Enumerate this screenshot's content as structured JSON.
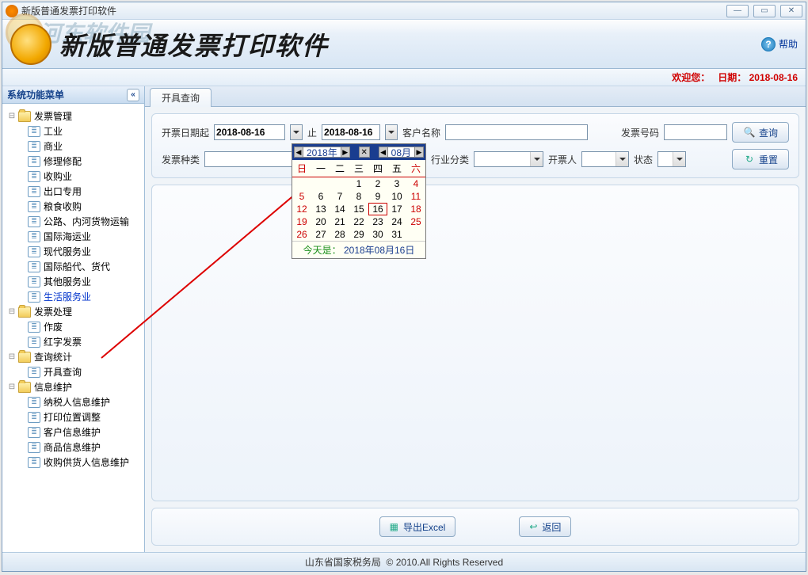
{
  "titlebar": {
    "title": "新版普通发票打印软件"
  },
  "header": {
    "watermark_text": "河东软件园",
    "app_title": "新版普通发票打印软件",
    "help": "帮助"
  },
  "statusline": {
    "welcome_prefix": "欢迎您：",
    "date_label": "日期：",
    "date_value": "2018-08-16"
  },
  "sidebar": {
    "title": "系统功能菜单",
    "groups": [
      {
        "label": "发票管理",
        "children": [
          "工业",
          "商业",
          "修理修配",
          "收购业",
          "出口专用",
          "粮食收购",
          "公路、内河货物运输",
          "国际海运业",
          "现代服务业",
          "国际船代、货代",
          "其他服务业",
          "生活服务业"
        ],
        "selected_index": 11
      },
      {
        "label": "发票处理",
        "children": [
          "作废",
          "红字发票"
        ]
      },
      {
        "label": "查询统计",
        "children": [
          "开具查询"
        ]
      },
      {
        "label": "信息维护",
        "children": [
          "纳税人信息维护",
          "打印位置调整",
          "客户信息维护",
          "商品信息维护",
          "收购供货人信息维护"
        ]
      }
    ]
  },
  "tab": {
    "label": "开具查询"
  },
  "search": {
    "date_from_label": "开票日期起",
    "date_from": "2018-08-16",
    "date_to_label": "止",
    "date_to": "2018-08-16",
    "customer_label": "客户名称",
    "invoice_no_label": "发票号码",
    "kind_label": "发票种类",
    "industry_label": "行业分类",
    "issuer_label": "开票人",
    "status_label": "状态",
    "query_btn": "查询",
    "reset_btn": "重置"
  },
  "bottom": {
    "export_btn": "导出Excel",
    "back_btn": "返回"
  },
  "footer": {
    "org": "山东省国家税务局",
    "copyright": "© 2010.All Rights Reserved"
  },
  "calendar": {
    "year": "2018年",
    "month": "08月",
    "dow": [
      "日",
      "一",
      "二",
      "三",
      "四",
      "五",
      "六"
    ],
    "cells": [
      [
        "",
        "",
        "",
        "1",
        "2",
        "3",
        "4"
      ],
      [
        "5",
        "6",
        "7",
        "8",
        "9",
        "10",
        "11"
      ],
      [
        "12",
        "13",
        "14",
        "15",
        "16",
        "17",
        "18"
      ],
      [
        "19",
        "20",
        "21",
        "22",
        "23",
        "24",
        "25"
      ],
      [
        "26",
        "27",
        "28",
        "29",
        "30",
        "31",
        ""
      ]
    ],
    "today_row": 2,
    "today_col": 4,
    "footer_t1": "今天是：",
    "footer_t2": "2018年08月16日"
  }
}
